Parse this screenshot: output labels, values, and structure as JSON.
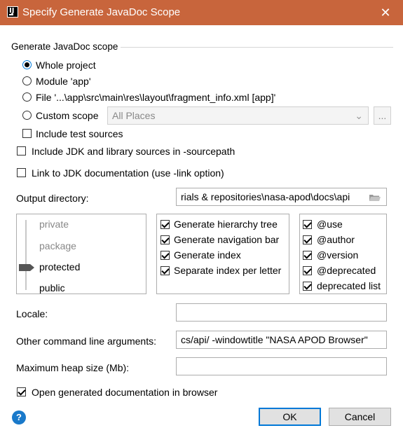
{
  "window": {
    "title": "Specify Generate JavaDoc Scope",
    "app_icon_text": "IJ"
  },
  "scope": {
    "group_label": "Generate JavaDoc scope",
    "options": [
      {
        "label": "Whole project",
        "checked": true
      },
      {
        "label": "Module 'app'",
        "checked": false
      },
      {
        "label": "File '...\\app\\src\\main\\res\\layout\\fragment_info.xml [app]'",
        "checked": false
      },
      {
        "label": "Custom scope",
        "checked": false
      }
    ],
    "custom_scope_value": "All Places",
    "browse_label": "...",
    "include_test_sources": {
      "label": "Include test sources",
      "checked": false
    }
  },
  "include_jdk": {
    "label": "Include JDK and library sources in -sourcepath",
    "checked": false
  },
  "link_jdk": {
    "label": "Link to JDK documentation (use -link option)",
    "checked": false
  },
  "output_dir": {
    "label": "Output directory:",
    "value": "rials & repositories\\nasa-apod\\docs\\api"
  },
  "visibility": {
    "levels": [
      "private",
      "package",
      "protected",
      "public"
    ],
    "selected": "protected"
  },
  "generate_options": [
    {
      "label": "Generate hierarchy tree",
      "checked": true
    },
    {
      "label": "Generate navigation bar",
      "checked": true
    },
    {
      "label": "Generate index",
      "checked": true
    },
    {
      "label": "Separate index per letter",
      "checked": true
    }
  ],
  "tag_options": [
    {
      "label": "@use",
      "checked": true
    },
    {
      "label": "@author",
      "checked": true
    },
    {
      "label": "@version",
      "checked": true
    },
    {
      "label": "@deprecated",
      "checked": true
    },
    {
      "label": "deprecated list",
      "checked": true
    }
  ],
  "locale": {
    "label": "Locale:",
    "value": ""
  },
  "cmd_args": {
    "label": "Other command line arguments:",
    "value": "cs/api/ -windowtitle \"NASA APOD Browser\""
  },
  "heap": {
    "label": "Maximum heap size (Mb):",
    "value": ""
  },
  "open_in_browser": {
    "label": "Open generated documentation in browser",
    "checked": true
  },
  "buttons": {
    "help": "?",
    "ok": "OK",
    "cancel": "Cancel"
  },
  "colors": {
    "titlebar": "#c8653c",
    "accent": "#0078d7",
    "help": "#1979ca"
  }
}
